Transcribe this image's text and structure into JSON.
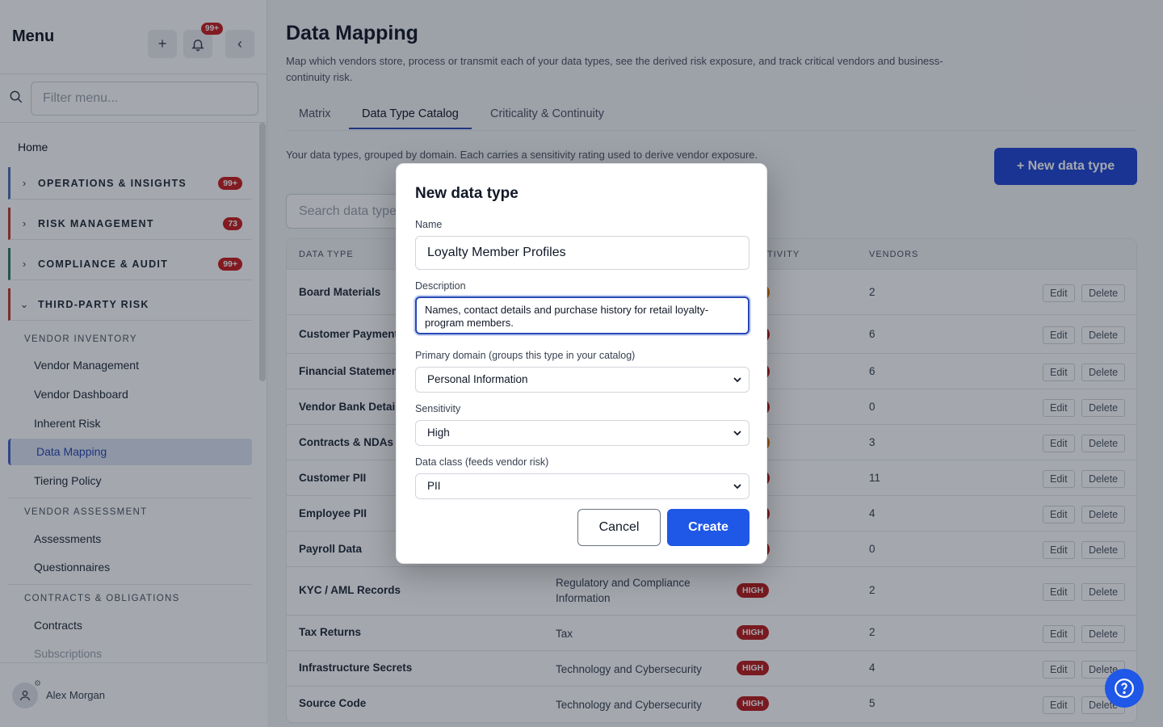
{
  "sidebar": {
    "title": "Menu",
    "notif_count": "99+",
    "filter_placeholder": "Filter menu...",
    "home": "Home",
    "groups": [
      {
        "label": "OPERATIONS & INSIGHTS",
        "count": "99+",
        "color": "#4b6fb5"
      },
      {
        "label": "RISK MANAGEMENT",
        "count": "73",
        "color": "#c0392b"
      },
      {
        "label": "COMPLIANCE & AUDIT",
        "count": "99+",
        "color": "#2e7d5b"
      },
      {
        "label": "THIRD-PARTY RISK",
        "count": "",
        "color": "#c0392b"
      }
    ],
    "subheads": [
      "VENDOR INVENTORY",
      "VENDOR ASSESSMENT",
      "CONTRACTS & OBLIGATIONS"
    ],
    "items": [
      "Vendor Management",
      "Vendor Dashboard",
      "Inherent Risk",
      "Data Mapping",
      "Tiering Policy",
      "Assessments",
      "Questionnaires",
      "Contracts",
      "Subscriptions"
    ],
    "user": "Alex Morgan"
  },
  "main": {
    "title": "Data Mapping",
    "description": "Map which vendors store, process or transmit each of your data types, see the derived risk exposure, and track critical vendors and business-continuity risk.",
    "tabs": [
      "Matrix",
      "Data Type Catalog",
      "Criticality & Continuity"
    ],
    "intro": "Your data types, grouped by domain. Each carries a sensitivity rating used to derive vendor exposure.",
    "new_button": "+ New data type",
    "search_placeholder": "Search data types...",
    "columns": [
      "DATA TYPE",
      "SENSITIVITY",
      "VENDORS"
    ],
    "edit_label": "Edit",
    "delete_label": "Delete",
    "rows": [
      {
        "name": "Board Materials",
        "domain": "",
        "sensitivity": "",
        "vendors": "2"
      },
      {
        "name": "Customer Payment",
        "domain": "",
        "sensitivity": "",
        "vendors": "6"
      },
      {
        "name": "Financial Statements",
        "domain": "",
        "sensitivity": "",
        "vendors": "6"
      },
      {
        "name": "Vendor Bank Details",
        "domain": "",
        "sensitivity": "",
        "vendors": "0"
      },
      {
        "name": "Contracts & NDAs",
        "domain": "",
        "sensitivity": "",
        "vendors": "3"
      },
      {
        "name": "Customer PII",
        "domain": "",
        "sensitivity": "",
        "vendors": "11"
      },
      {
        "name": "Employee PII",
        "domain": "",
        "sensitivity": "",
        "vendors": "4"
      },
      {
        "name": "Payroll Data",
        "domain": "",
        "sensitivity": "",
        "vendors": "0"
      },
      {
        "name": "KYC / AML Records",
        "domain": "Regulatory and Compliance Information",
        "sensitivity": "HIGH",
        "vendors": "2"
      },
      {
        "name": "Tax Returns",
        "domain": "Tax",
        "sensitivity": "HIGH",
        "vendors": "2"
      },
      {
        "name": "Infrastructure Secrets",
        "domain": "Technology and Cybersecurity",
        "sensitivity": "HIGH",
        "vendors": "4"
      },
      {
        "name": "Source Code",
        "domain": "Technology and Cybersecurity",
        "sensitivity": "HIGH",
        "vendors": "5"
      }
    ]
  },
  "modal": {
    "title": "New data type",
    "name_label": "Name",
    "name_value": "Loyalty Member Profiles",
    "description_label": "Description",
    "description_value": "Names, contact details and purchase history for retail loyalty-program members.",
    "domain_label": "Primary domain (groups this type in your catalog)",
    "domain_value": "Personal Information",
    "sensitivity_label": "Sensitivity",
    "sensitivity_value": "High",
    "class_label": "Data class (feeds vendor risk)",
    "class_value": "PII",
    "cancel": "Cancel",
    "create": "Create"
  },
  "colors": {
    "accent": "#1f57e6",
    "danger": "#b91c1c"
  }
}
